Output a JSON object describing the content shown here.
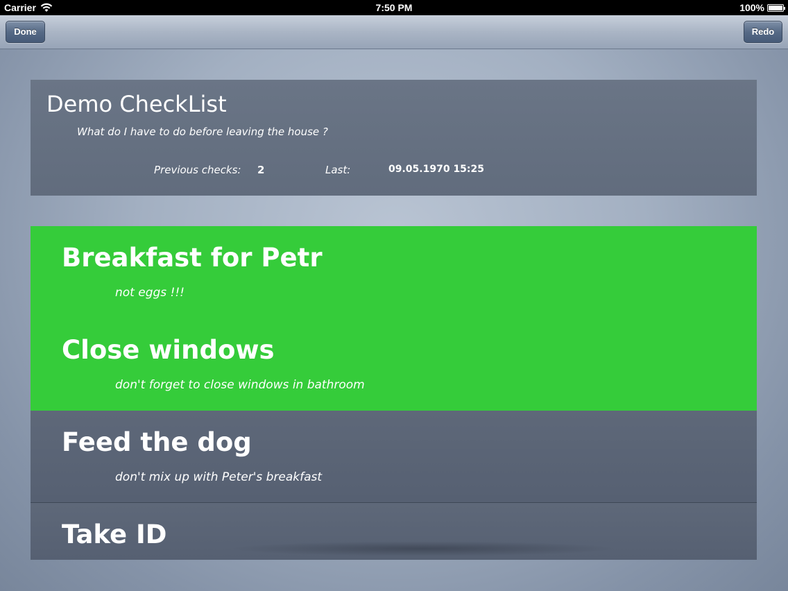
{
  "status_bar": {
    "carrier": "Carrier",
    "time": "7:50 PM",
    "battery": "100%"
  },
  "nav": {
    "done_label": "Done",
    "redo_label": "Redo"
  },
  "checklist": {
    "title": "Demo CheckList",
    "description": "What do I have to do before leaving the house ?",
    "previous_checks_label": "Previous checks:",
    "previous_checks_value": "2",
    "last_label": "Last:",
    "last_value": "09.05.1970 15:25"
  },
  "items": [
    {
      "title": "Breakfast for Petr",
      "note": "not eggs !!!",
      "checked": true
    },
    {
      "title": "Close windows",
      "note": "don't forget to close windows in bathroom",
      "checked": true
    },
    {
      "title": "Feed the dog",
      "note": "don't mix up with Peter's breakfast",
      "checked": false
    },
    {
      "title": "Take ID",
      "note": "",
      "checked": false
    }
  ],
  "colors": {
    "checked": "#35cc3a",
    "unchecked": "#5e6879",
    "nav_button": "#566a86"
  },
  "icons": {
    "wifi": "wifi-icon",
    "battery": "battery-icon"
  }
}
